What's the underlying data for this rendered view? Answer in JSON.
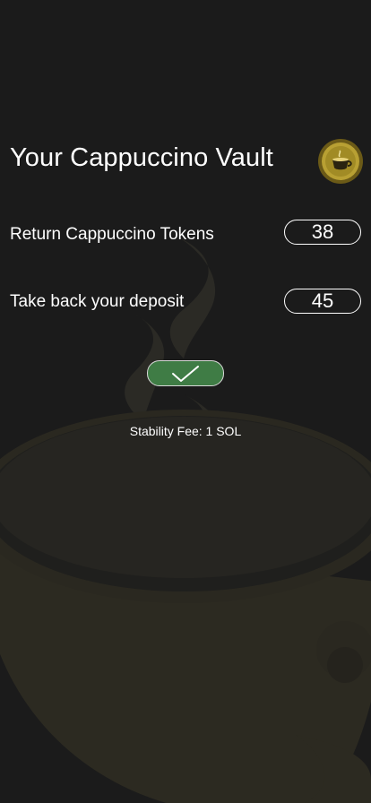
{
  "vault": {
    "title": "Your Cappuccino Vault",
    "coin_icon": "cappuccino-coin-icon"
  },
  "rows": [
    {
      "label": "Return Cappuccino Tokens",
      "value": "38"
    },
    {
      "label": "Take back your deposit",
      "value": "45"
    }
  ],
  "confirm": {
    "icon": "checkmark-icon",
    "color": "#3f7c45"
  },
  "fee": {
    "text": "Stability Fee: 1 SOL"
  },
  "theme": {
    "background": "#1b1b1b",
    "art_color": "#2e2a1e",
    "coin_color": "#b8a033"
  }
}
